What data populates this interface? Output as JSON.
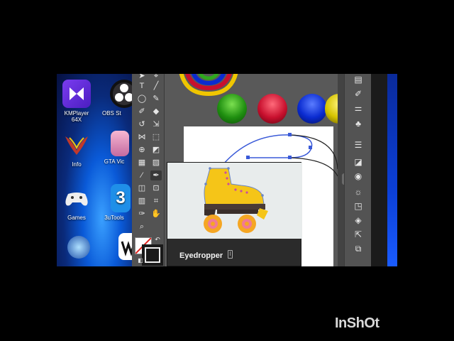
{
  "desktop": {
    "icons": [
      {
        "label": "KMPlayer 64X"
      },
      {
        "label": "OBS St"
      },
      {
        "label": "Info"
      },
      {
        "label": "GTA Vic"
      },
      {
        "label": "Games"
      },
      {
        "label": "3uTools"
      }
    ]
  },
  "tooltip": {
    "tool_name": "Eyedropper",
    "shortcut": "I"
  },
  "swatches": {
    "colors": [
      "#2fa81e",
      "#c8102e",
      "#0a2bd0",
      "#d6c400"
    ]
  },
  "watermark": {
    "text": "InShOt"
  },
  "icons": {
    "toolbar": [
      "selection-icon",
      "direct-select-icon",
      "pen-icon",
      "curvature-icon",
      "type-icon",
      "line-icon",
      "rectangle-icon",
      "paintbrush-icon",
      "shaper-icon",
      "eraser-icon",
      "rotate-icon",
      "scale-icon",
      "width-icon",
      "free-transform-icon",
      "shape-builder-icon",
      "perspective-icon",
      "mesh-icon",
      "gradient-icon",
      "eyedropper-icon",
      "blend-icon",
      "symbol-sprayer-icon",
      "graph-icon",
      "artboard-icon",
      "slice-icon",
      "hand-icon",
      "zoom-icon",
      "fill-swatch-icon",
      "stroke-swatch-icon"
    ]
  }
}
